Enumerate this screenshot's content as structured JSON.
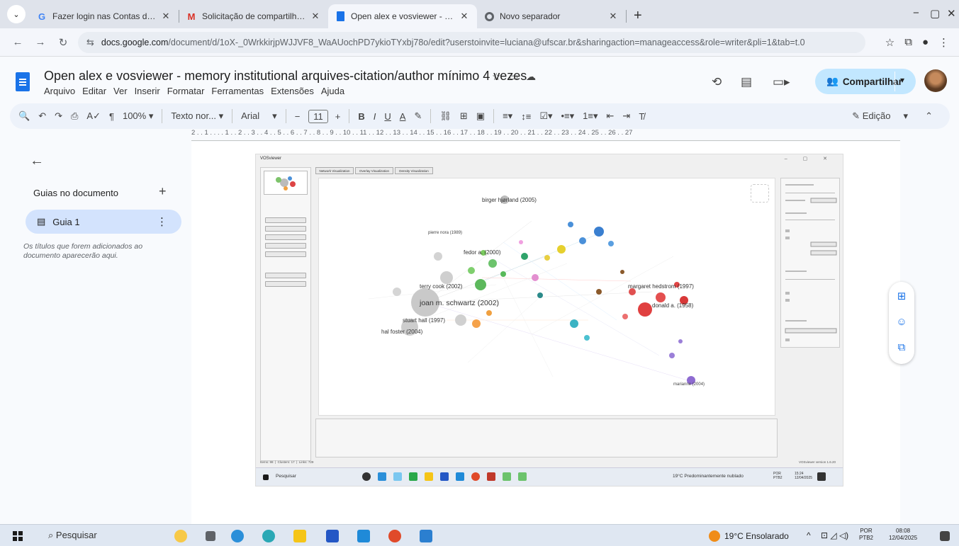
{
  "browser": {
    "tabs": [
      {
        "title": "Fazer login nas Contas do Goo",
        "favicon": "G",
        "color": "#4285f4"
      },
      {
        "title": "Solicitação de compartilhamen",
        "favicon": "M",
        "color": "#d93025"
      },
      {
        "title": "Open alex e vosviewer - memo",
        "favicon": "docs-icon",
        "color": "#1a73e8"
      },
      {
        "title": "Novo separador",
        "favicon": "chrome-icon",
        "color": "#333333"
      }
    ],
    "url_domain": "docs.google.com",
    "url_path": "/document/d/1oX-_0WrkkirjpWJJVF8_WaAUochPD7ykioTYxbj78o/edit?userstoinvite=luciana@ufscar.br&sharingaction=manageaccess&role=writer&pli=1&tab=t.0"
  },
  "doc": {
    "title": "Open alex e vosviewer - memory institutional arquives-citation/author mínimo 4 vezes",
    "menu": [
      "Arquivo",
      "Editar",
      "Ver",
      "Inserir",
      "Formatar",
      "Ferramentas",
      "Extensões",
      "Ajuda"
    ],
    "share_label": "Compartilhar"
  },
  "toolbar": {
    "zoom": "100%",
    "style": "Texto nor...",
    "font": "Arial",
    "font_size": "11",
    "mode": "Edição"
  },
  "ruler": "2 . . 1 . . . . 1 . . 2 . . 3 . . 4 . . 5 . . 6 . . 7 . . 8 . . 9 . . 10 . . 11 . . 12 . . 13 . . 14 . . 15 . . 16 . . 17 . . 18 . . 19 . . 20 . . 21 . . 22 . . 23 . . 24 . 25 . . 26 . . 27",
  "outline": {
    "header": "Guias no documento",
    "guide": "Guia 1",
    "note": "Os títulos que forem adicionados ao documento aparecerão aqui."
  },
  "screenshot": {
    "window_title": "VOSviewer",
    "labels": {
      "l1": "birger hjørland (2005)",
      "l2": "joan m. schwartz (2002)",
      "l3": "hal foster (2004)",
      "l4": "donald a. (1958)",
      "l5": "terry cook (2002)",
      "l6": "margaret hedstrom (1997)",
      "l7": "marianne (2004)",
      "l8": "stuart hall (1997)",
      "l9": "fedor a. (2000)",
      "l10": "pierre nora (1989)"
    },
    "search_placeholder": "Pesquisar",
    "weather": "19°C Predominantemente nublado",
    "lang": "POR\nPTB2",
    "clock": "15:24\n12/04/2025"
  },
  "taskbar": {
    "search_label": "Pesquisar",
    "weather": "19°C Ensolarado",
    "lang_top": "POR",
    "lang_bottom": "PTB2",
    "time": "08:08",
    "date": "12/04/2025"
  },
  "colors": {
    "share_button": "#c2e7ff",
    "guide_highlight": "#d3e3fd",
    "toolbar_bg": "#edf2fa",
    "accent_blue": "#1a73e8"
  }
}
